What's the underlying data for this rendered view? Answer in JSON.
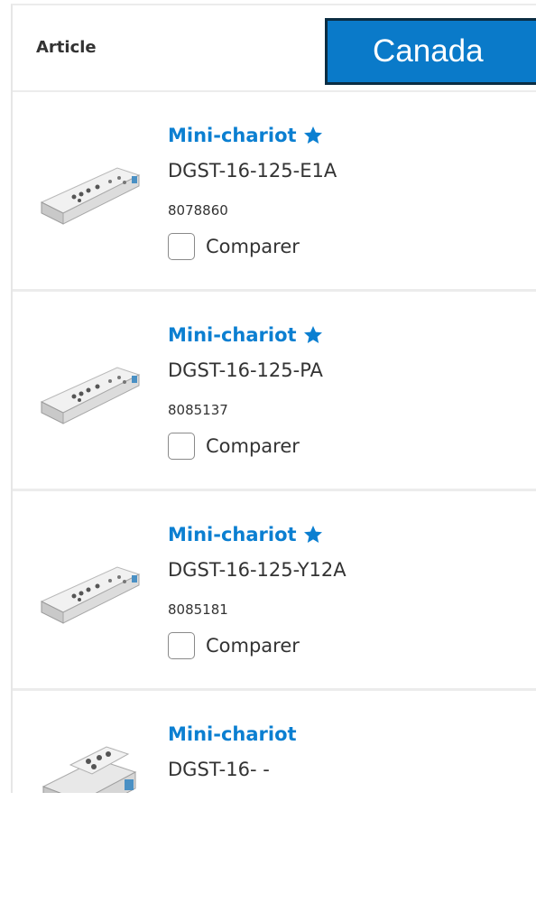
{
  "header": {
    "article_label": "Article"
  },
  "badge": {
    "region": "Canada"
  },
  "products": [
    {
      "title": "Mini-chariot",
      "model": "DGST-16-125-E1A",
      "code": "8078860",
      "compare_label": "Comparer",
      "starred": true
    },
    {
      "title": "Mini-chariot",
      "model": "DGST-16-125-PA",
      "code": "8085137",
      "compare_label": "Comparer",
      "starred": true
    },
    {
      "title": "Mini-chariot",
      "model": "DGST-16-125-Y12A",
      "code": "8085181",
      "compare_label": "Comparer",
      "starred": true
    },
    {
      "title": "Mini-chariot",
      "model": "DGST-16- -",
      "code": "",
      "compare_label": "",
      "starred": false
    }
  ],
  "colors": {
    "link": "#0b7fd1",
    "badge_bg": "#0a7ac9",
    "badge_border": "#0b2d43"
  }
}
